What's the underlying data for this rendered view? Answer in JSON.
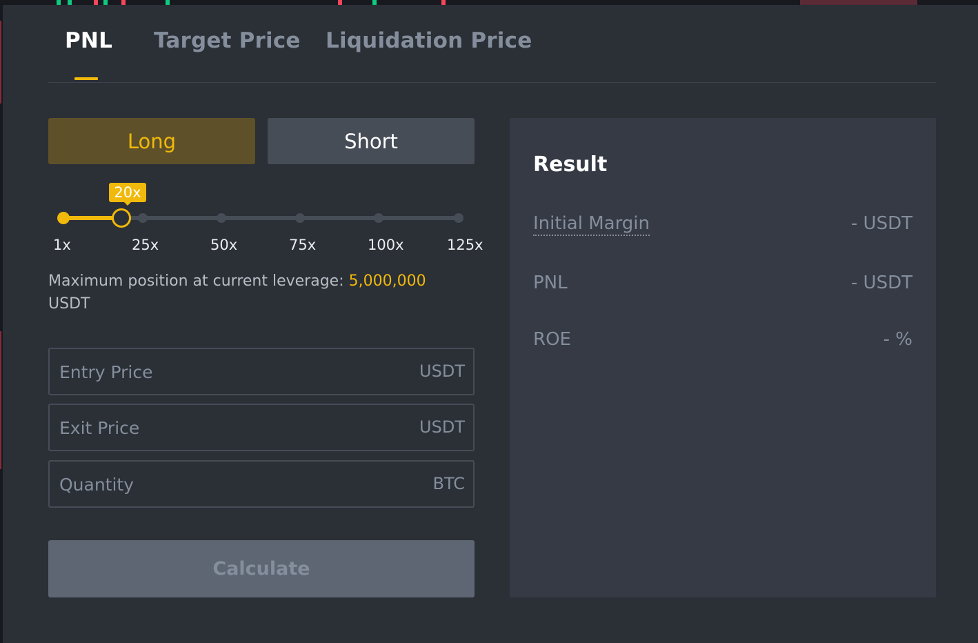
{
  "colors": {
    "accent": "#f0b90b",
    "background": "#2b2f36",
    "panel": "#363a45",
    "muted": "#848e9c"
  },
  "tabs": [
    {
      "label": "PNL",
      "active": true
    },
    {
      "label": "Target Price",
      "active": false
    },
    {
      "label": "Liquidation Price",
      "active": false
    }
  ],
  "position_side": {
    "long_label": "Long",
    "short_label": "Short",
    "selected": "Long"
  },
  "leverage": {
    "current_label": "20x",
    "current_value": 20,
    "marks": [
      "1x",
      "25x",
      "50x",
      "75x",
      "100x",
      "125x"
    ],
    "max_position_text": "Maximum position at current leverage: ",
    "max_position_value": "5,000,000",
    "max_position_unit": "USDT"
  },
  "inputs": {
    "entry_price": {
      "placeholder": "Entry Price",
      "unit": "USDT"
    },
    "exit_price": {
      "placeholder": "Exit Price",
      "unit": "USDT"
    },
    "quantity": {
      "placeholder": "Quantity",
      "unit": "BTC"
    }
  },
  "calculate_label": "Calculate",
  "result": {
    "title": "Result",
    "rows": [
      {
        "label": "Initial Margin",
        "value": "- USDT"
      },
      {
        "label": "PNL",
        "value": "- USDT"
      },
      {
        "label": "ROE",
        "value": "- %"
      }
    ]
  }
}
